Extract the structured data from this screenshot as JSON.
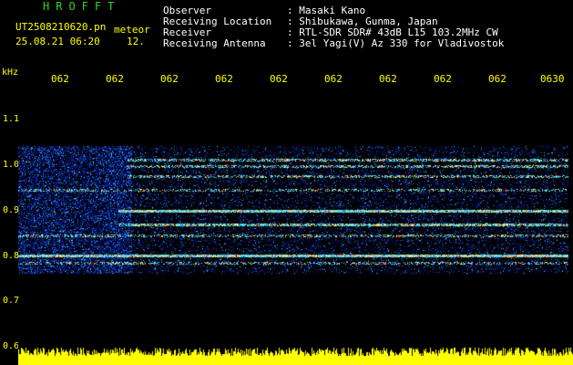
{
  "logo": "HROFFT",
  "file": {
    "name": "UT2508210620.pn",
    "suffix": "meteor",
    "datetime": "25.08.21 06:20",
    "page": "12."
  },
  "header": {
    "observer_label": "Observer",
    "observer_value": ": Masaki Kano",
    "location_label": "Receiving Location",
    "location_value": ": Shibukawa, Gunma, Japan",
    "receiver_label": "Receiver",
    "receiver_value": ": RTL-SDR SDR# 43dB L15 103.2MHz CW",
    "antenna_label": "Receiving Antenna",
    "antenna_value": ": 3el Yagi(V) Az 330 for Vladivostok"
  },
  "axis": {
    "unit": "kHz",
    "time_ticks": [
      "062",
      "062",
      "062",
      "062",
      "062",
      "062",
      "062",
      "062",
      "062",
      "0630"
    ],
    "freq_ticks": [
      "1.1",
      "1.0",
      "0.9",
      "0.8",
      "0.7",
      "0.6"
    ]
  },
  "colors": {
    "accent": "#ffff00",
    "logo": "#2bd62b",
    "signal_low": "#0a1aa0",
    "signal_mid": "#1ec8ff",
    "signal_high": "#ff2020"
  }
}
